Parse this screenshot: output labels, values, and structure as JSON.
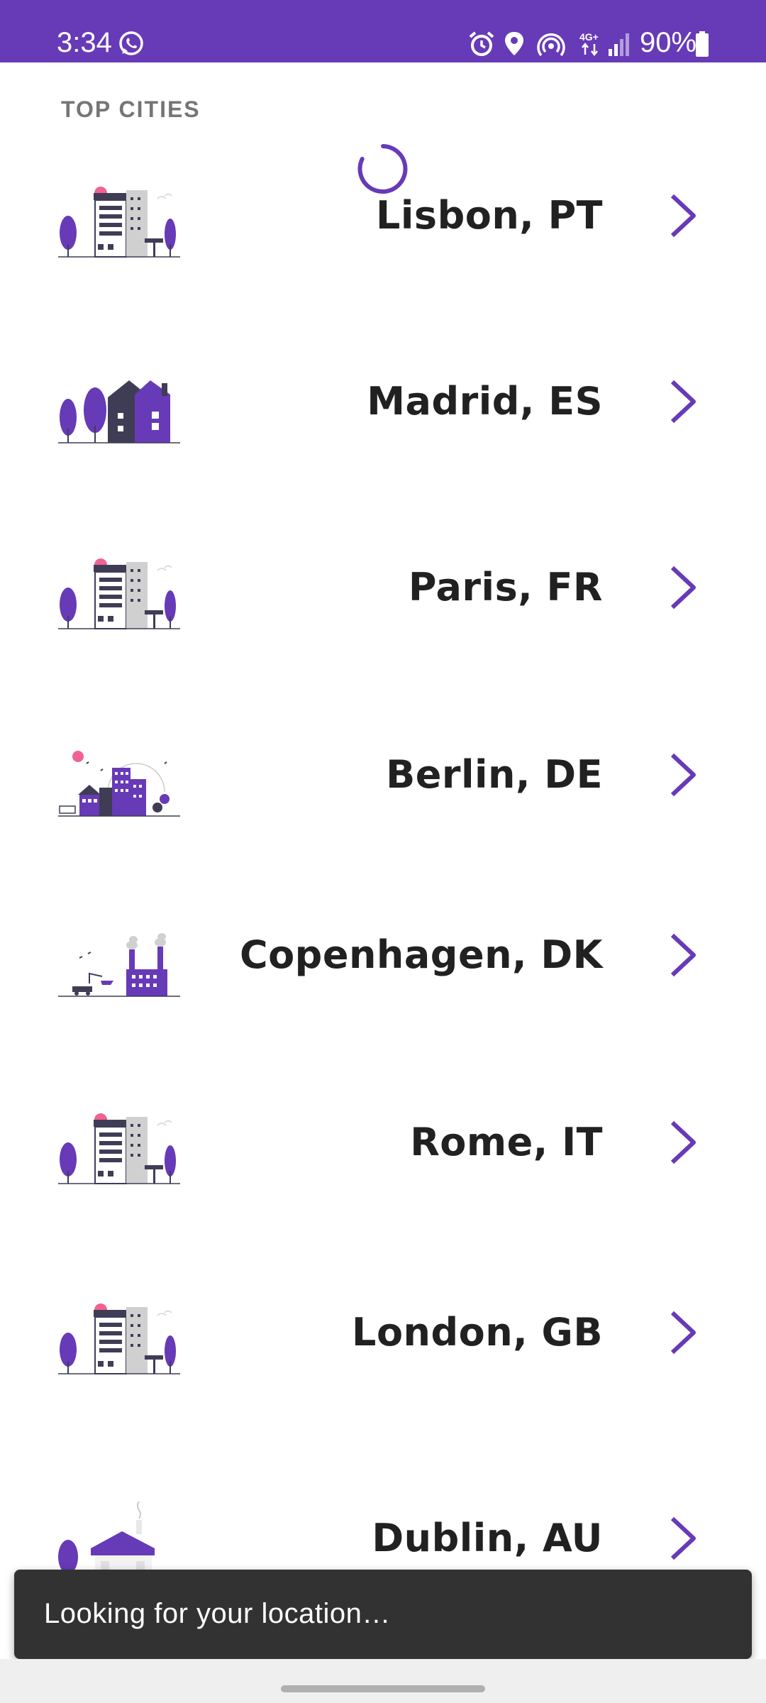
{
  "status_bar": {
    "time": "3:34",
    "battery": "90%",
    "network": "4G+",
    "icons": [
      "whatsapp-icon",
      "alarm-icon",
      "location-icon",
      "hotspot-icon",
      "network-4g-icon",
      "signal-icon",
      "battery-icon"
    ],
    "background": "#673ab7"
  },
  "section": {
    "header": "TOP CITIES"
  },
  "loading_indicator": {
    "color": "#673ab7"
  },
  "cities": [
    {
      "name": "Lisbon, PT",
      "illustration": "tall-building-illustration"
    },
    {
      "name": "Madrid, ES",
      "illustration": "house-trees-illustration"
    },
    {
      "name": "Paris, FR",
      "illustration": "tall-building-illustration"
    },
    {
      "name": "Berlin, DE",
      "illustration": "cityscape-illustration"
    },
    {
      "name": "Copenhagen, DK",
      "illustration": "factory-illustration"
    },
    {
      "name": "Rome, IT",
      "illustration": "tall-building-illustration"
    },
    {
      "name": "London, GB",
      "illustration": "tall-building-illustration"
    },
    {
      "name": "Dublin, AU",
      "illustration": "cottage-illustration"
    }
  ],
  "snackbar": {
    "message": "Looking for your location…"
  },
  "colors": {
    "accent": "#673ab7",
    "text": "#212121",
    "header": "#757575",
    "snackbar": "#323232"
  }
}
